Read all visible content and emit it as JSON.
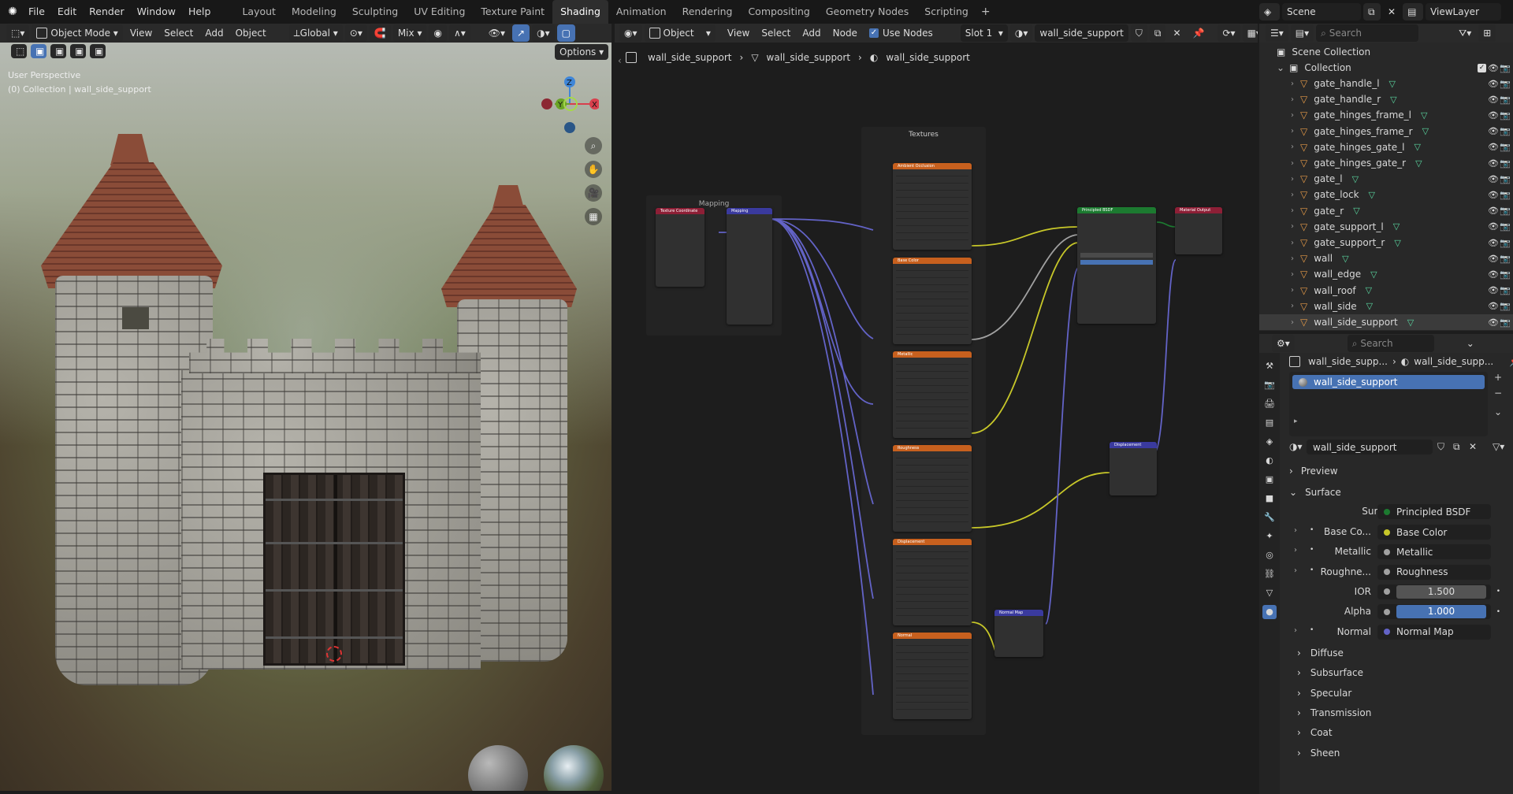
{
  "menu": [
    "File",
    "Edit",
    "Render",
    "Window",
    "Help"
  ],
  "workspaces": [
    "Layout",
    "Modeling",
    "Sculpting",
    "UV Editing",
    "Texture Paint",
    "Shading",
    "Animation",
    "Rendering",
    "Compositing",
    "Geometry Nodes",
    "Scripting"
  ],
  "active_workspace": "Shading",
  "scene": {
    "label": "Scene",
    "view_layer": "ViewLayer"
  },
  "viewport": {
    "mode": "Object Mode",
    "menus": [
      "View",
      "Select",
      "Add",
      "Object"
    ],
    "orientation": "Global",
    "shading": "Mix",
    "options": "Options",
    "overlay_title": "User Perspective",
    "overlay_sub": "(0) Collection | wall_side_support",
    "axes": {
      "z": "Z",
      "y": "Y",
      "x": "X"
    }
  },
  "node_editor": {
    "type": "Object",
    "menus": [
      "View",
      "Select",
      "Add",
      "Node"
    ],
    "use_nodes": "Use Nodes",
    "slot": "Slot 1",
    "material": "wall_side_support",
    "breadcrumb": [
      "wall_side_support",
      "wall_side_support",
      "wall_side_support"
    ],
    "frames": {
      "mapping": "Mapping",
      "textures": "Textures"
    },
    "tex_nodes": [
      "Ambient Occlusion",
      "Base Color",
      "Metallic",
      "Roughness",
      "Displacement",
      "Normal"
    ],
    "other_nodes": {
      "texcoord": "Texture Coordinate",
      "mapping": "Mapping",
      "bsdf": "Principled BSDF",
      "output": "Material Output",
      "displacement": "Displacement",
      "normalmap": "Normal Map"
    }
  },
  "outliner": {
    "search": "Search",
    "root": "Scene Collection",
    "collection": "Collection",
    "items": [
      "gate_handle_l",
      "gate_handle_r",
      "gate_hinges_frame_l",
      "gate_hinges_frame_r",
      "gate_hinges_gate_l",
      "gate_hinges_gate_r",
      "gate_l",
      "gate_lock",
      "gate_r",
      "gate_support_l",
      "gate_support_r",
      "wall",
      "wall_edge",
      "wall_roof",
      "wall_side",
      "wall_side_support"
    ]
  },
  "properties": {
    "search": "Search",
    "breadcrumb": [
      "wall_side_supp...",
      "wall_side_supp..."
    ],
    "slot_item": "wall_side_support",
    "material_name": "wall_side_support",
    "sections": {
      "preview": "Preview",
      "surface": "Surface"
    },
    "surface": {
      "surface_label": "Surface",
      "surface_value": "Principled BSDF",
      "rows": [
        {
          "label": "Base Co...",
          "value": "Base Color",
          "color": "#c7c729",
          "expand": true
        },
        {
          "label": "Metallic",
          "value": "Metallic",
          "color": "#a1a1a1",
          "expand": true
        },
        {
          "label": "Roughne...",
          "value": "Roughness",
          "color": "#a1a1a1",
          "expand": true
        },
        {
          "label": "IOR",
          "value": "1.500",
          "color": "#a1a1a1",
          "expand": false
        },
        {
          "label": "Alpha",
          "value": "1.000",
          "color": "#a1a1a1",
          "expand": false
        },
        {
          "label": "Normal",
          "value": "Normal Map",
          "color": "#6363c7",
          "expand": true
        }
      ]
    },
    "subsections": [
      "Diffuse",
      "Subsurface",
      "Specular",
      "Transmission",
      "Coat",
      "Sheen"
    ]
  },
  "colors": {
    "accent": "#4772b3",
    "tex_header": "#c7601e",
    "bsdf_header": "#1c7a30",
    "vector_link": "#6363c7",
    "color_link": "#c7c729",
    "gray_link": "#a1a1a1"
  }
}
